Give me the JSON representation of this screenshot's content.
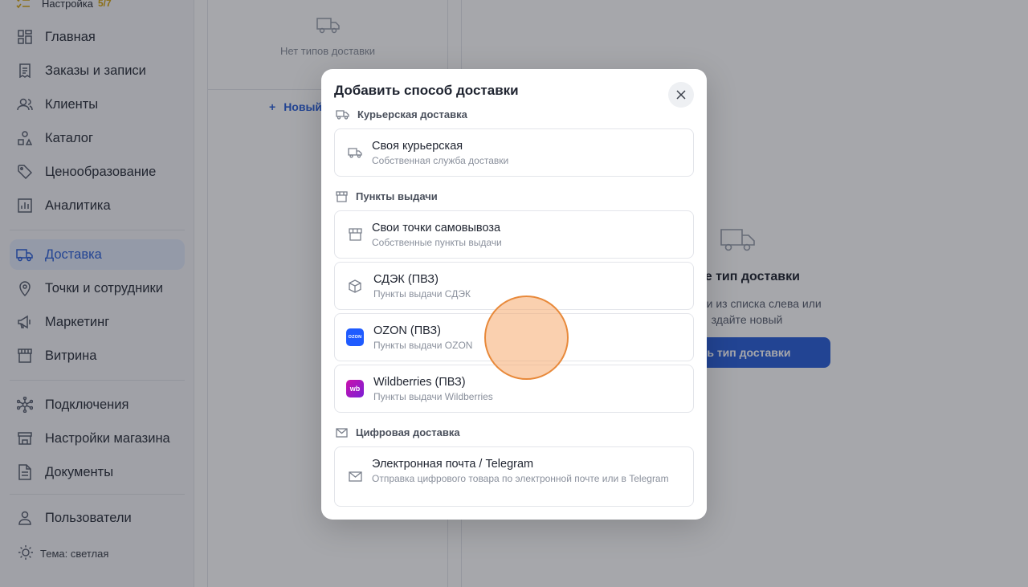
{
  "sidebar": {
    "setup": {
      "label": "Настройка",
      "count": "5/7"
    },
    "items": [
      {
        "label": "Главная",
        "icon": "grid-icon"
      },
      {
        "label": "Заказы и записи",
        "icon": "receipt-icon"
      },
      {
        "label": "Клиенты",
        "icon": "users-icon"
      },
      {
        "label": "Каталог",
        "icon": "shapes-icon"
      },
      {
        "label": "Ценообразование",
        "icon": "tag-icon"
      },
      {
        "label": "Аналитика",
        "icon": "chart-icon"
      },
      {
        "label": "Доставка",
        "icon": "truck-icon",
        "active": true
      },
      {
        "label": "Точки и сотрудники",
        "icon": "pin-icon"
      },
      {
        "label": "Маркетинг",
        "icon": "megaphone-icon"
      },
      {
        "label": "Витрина",
        "icon": "store-icon"
      },
      {
        "label": "Подключения",
        "icon": "network-icon"
      },
      {
        "label": "Настройки магазина",
        "icon": "store-settings-icon"
      },
      {
        "label": "Документы",
        "icon": "document-icon"
      },
      {
        "label": "Пользователи",
        "icon": "user-icon"
      }
    ],
    "theme_label": "Тема: светлая"
  },
  "middle": {
    "empty_text": "Нет типов доставки",
    "new_button": "Новый"
  },
  "right": {
    "title": "ите тип доставки",
    "desc_line1": "оставки из списка слева или",
    "desc_line2": "здайте новый",
    "button": "авить тип доставки"
  },
  "modal": {
    "title": "Добавить способ доставки",
    "sections": [
      {
        "title": "Курьерская доставка",
        "icon": "truck-icon",
        "options": [
          {
            "title": "Своя курьерская",
            "subtitle": "Собственная служба доставки",
            "icon": "truck-icon"
          }
        ]
      },
      {
        "title": "Пункты выдачи",
        "icon": "store-icon",
        "options": [
          {
            "title": "Свои точки самовывоза",
            "subtitle": "Собственные пункты выдачи",
            "icon": "store-icon"
          },
          {
            "title": "СДЭК (ПВЗ)",
            "subtitle": "Пункты выдачи СДЭК",
            "icon": "box-icon"
          },
          {
            "title": "OZON (ПВЗ)",
            "subtitle": "Пункты выдачи OZON",
            "icon": "ozon-logo",
            "logo_text": "OZON",
            "logo_color": "#1f5bff"
          },
          {
            "title": "Wildberries (ПВЗ)",
            "subtitle": "Пункты выдачи Wildberries",
            "icon": "wildberries-logo",
            "logo_text": "wb",
            "logo_color": "#cb11ab"
          }
        ]
      },
      {
        "title": "Цифровая доставка",
        "icon": "mail-icon",
        "options": [
          {
            "title": "Электронная почта / Telegram",
            "subtitle": "Отправка цифрового товара по электронной почте или в Telegram",
            "icon": "mail-icon"
          }
        ]
      }
    ]
  },
  "colors": {
    "accent": "#2b5fd9",
    "active_bg": "#e3eafb",
    "setup_count": "#d4a40f",
    "touch_indicator": "#e8893a"
  }
}
